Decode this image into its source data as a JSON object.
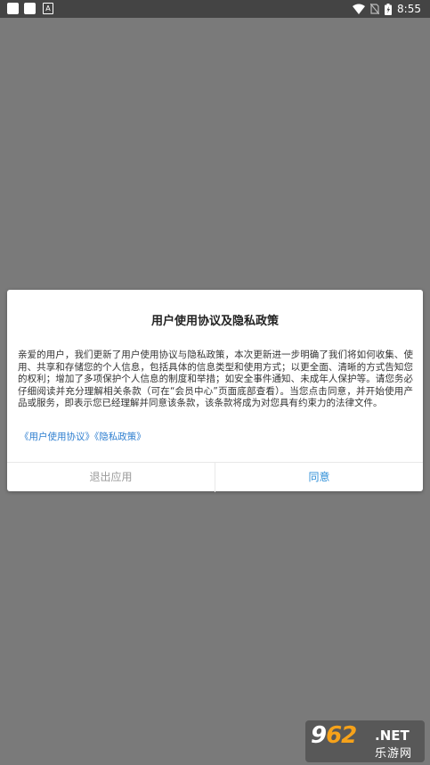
{
  "status_bar": {
    "time": "8:55",
    "notification_a_label": "A",
    "icons": [
      "notification-icon",
      "notification-icon",
      "a-icon",
      "wifi-icon",
      "no-sim-icon",
      "battery-icon"
    ]
  },
  "dialog": {
    "title": "用户使用协议及隐私政策",
    "body": "亲爱的用户，我们更新了用户使用协议与隐私政策，本次更新进一步明确了我们将如何收集、使用、共享和存储您的个人信息，包括具体的信息类型和使用方式；以更全面、清晰的方式告知您的权利；增加了多项保护个人信息的制度和举措；如安全事件通知、未成年人保护等。请您务必仔细阅读并充分理解相关条款（可在“会员中心”页面底部查看）。当您点击同意，并开始使用产品或服务，即表示您已经理解并同意该条款，该条款将成为对您具有约束力的法律文件。",
    "link_user_agreement": "《用户使用协议》",
    "link_privacy_policy": "《隐私政策》",
    "exit_label": "退出应用",
    "agree_label": "同意"
  },
  "watermark": {
    "brand_prefix": "9",
    "brand_highlight": "62",
    "brand_suffix": ".NET",
    "subtitle": "乐游网"
  },
  "colors": {
    "overlay": "#7a7a7a",
    "link": "#2f7fd0",
    "agree": "#2f8fd8",
    "exit": "#9a9a9a"
  }
}
